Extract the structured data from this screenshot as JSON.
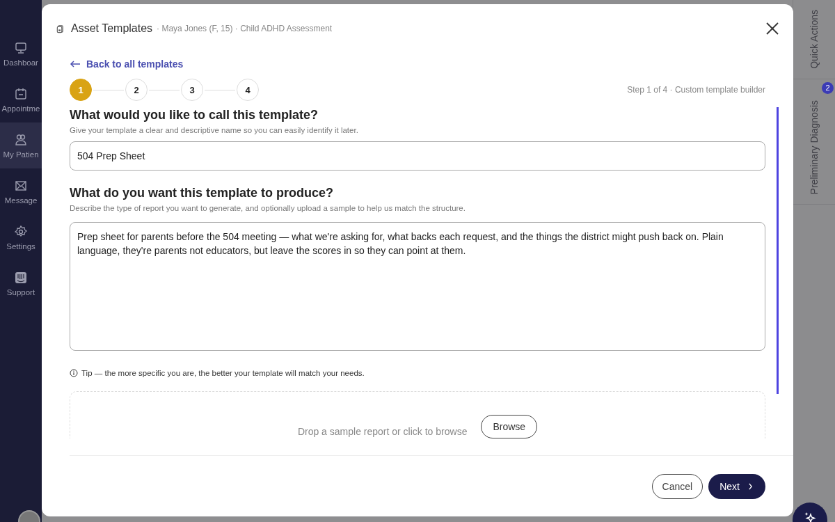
{
  "sidebar": {
    "items": [
      {
        "label": "Dashboar",
        "selected": false
      },
      {
        "label": "Appointme",
        "selected": false
      },
      {
        "label": "My Patien",
        "selected": true
      },
      {
        "label": "Message",
        "selected": false
      },
      {
        "label": "Settings",
        "selected": false
      },
      {
        "label": "Support",
        "selected": false
      }
    ]
  },
  "right_rail": {
    "tabs": [
      {
        "label": "Quick Actions"
      },
      {
        "label": "Preliminary Diagnosis",
        "badge": "2"
      }
    ]
  },
  "modal": {
    "title": "Asset Templates",
    "subtitle": "· Maya Jones (F, 15) · Child ADHD Assessment",
    "back_link": "Back to all templates",
    "steps": [
      {
        "label": "1",
        "selected": true
      },
      {
        "label": "2",
        "selected": false
      },
      {
        "label": "3",
        "selected": false
      },
      {
        "label": "4",
        "selected": false
      }
    ],
    "step_caption": "Step 1 of 4 · Custom template builder",
    "name_section": {
      "heading": "What would you like to call this template?",
      "help": "Give your template a clear and descriptive name so you can easily identify it later.",
      "value": "504 Prep Sheet"
    },
    "produce_section": {
      "heading": "What do you want this template to produce?",
      "help": "Describe the type of report you want to generate, and optionally upload a sample to help us match the structure.",
      "value": "Prep sheet for parents before the 504 meeting — what we're asking for, what backs each request, and the things the district might push back on. Plain language, they're parents not educators, but leave the scores in so they can point at them."
    },
    "tip": "Tip — the more specific you are, the better your template will match your needs.",
    "dropzone": {
      "text": "Drop a sample report or click to browse",
      "button": "Browse"
    },
    "buttons": {
      "cancel": "Cancel",
      "next": "Next"
    }
  }
}
